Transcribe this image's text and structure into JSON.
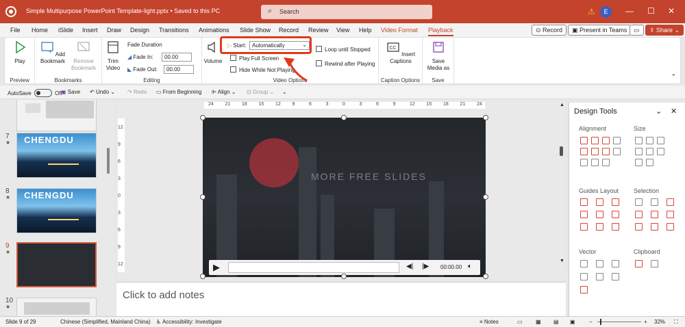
{
  "titlebar": {
    "filename": "Simple Multipurpose PowerPoint Template-light.pptx",
    "saved": "•  Saved to this PC",
    "search_placeholder": "Search",
    "avatar": "E"
  },
  "tabs": [
    "File",
    "Home",
    "iSlide",
    "Insert",
    "Draw",
    "Design",
    "Transitions",
    "Animations",
    "Slide Show",
    "Record",
    "Review",
    "View",
    "Help",
    "Video Format",
    "Playback"
  ],
  "active_tab": "Playback",
  "tab_buttons": {
    "record": "Record",
    "present": "Present in Teams",
    "share": "Share"
  },
  "ribbon": {
    "preview": {
      "label": "Preview",
      "play": "Play"
    },
    "bookmarks": {
      "label": "Bookmarks",
      "add": "Add\nBookmark",
      "remove": "Remove\nBookmark"
    },
    "editing": {
      "label": "Editing",
      "trim": "Trim\nVideo",
      "fade_title": "Fade Duration",
      "fade_in": "Fade In:",
      "fade_out": "Fade Out:",
      "fade_in_value": "00.00",
      "fade_out_value": "00.00"
    },
    "video_options": {
      "label": "Video Options",
      "volume": "Volume",
      "start_label": "Start:",
      "start_value": "Automatically",
      "play_full_screen": "Play Full Screen",
      "hide_while_not_playing": "Hide While Not Playing",
      "loop_until_stopped": "Loop until Stopped",
      "rewind_after_playing": "Rewind after Playing"
    },
    "caption_options": {
      "label": "Caption Options",
      "insert": "Insert\nCaptions"
    },
    "save": {
      "label": "Save",
      "save_media": "Save\nMedia as"
    }
  },
  "qat": {
    "autosave": "AutoSave",
    "off": "Off",
    "save": "Save",
    "undo": "Undo",
    "redo": "Redo",
    "from_beginning": "From Beginning",
    "align": "Align",
    "group": "Group"
  },
  "slides": [
    {
      "num": "7",
      "title": "CHENGDU"
    },
    {
      "num": "8",
      "title": "CHENGDU"
    },
    {
      "num": "9",
      "title": ""
    },
    {
      "num": "10",
      "title": ""
    }
  ],
  "ruler": {
    "h": [
      "24",
      "21",
      "18",
      "15",
      "12",
      "9",
      "6",
      "3",
      "0",
      "3",
      "6",
      "9",
      "12",
      "15",
      "18",
      "21",
      "24"
    ],
    "v": [
      "12",
      "9",
      "6",
      "3",
      "0",
      "3",
      "6",
      "9",
      "12"
    ]
  },
  "video": {
    "watermark": "MORE FREE SLIDES",
    "time": "00:00.00"
  },
  "notes_placeholder": "Click to add notes",
  "design_tools": {
    "title": "Design Tools",
    "alignment": "Alignment",
    "size": "Size",
    "guides_layout": "Guides Layout",
    "selection": "Selection",
    "vector": "Vector",
    "clipboard": "Clipboard"
  },
  "status": {
    "slide": "Slide 9 of 29",
    "language": "Chinese (Simplified, Mainland China)",
    "accessibility": "Accessibility: Investigate",
    "notes": "Notes",
    "zoom": "32%"
  }
}
